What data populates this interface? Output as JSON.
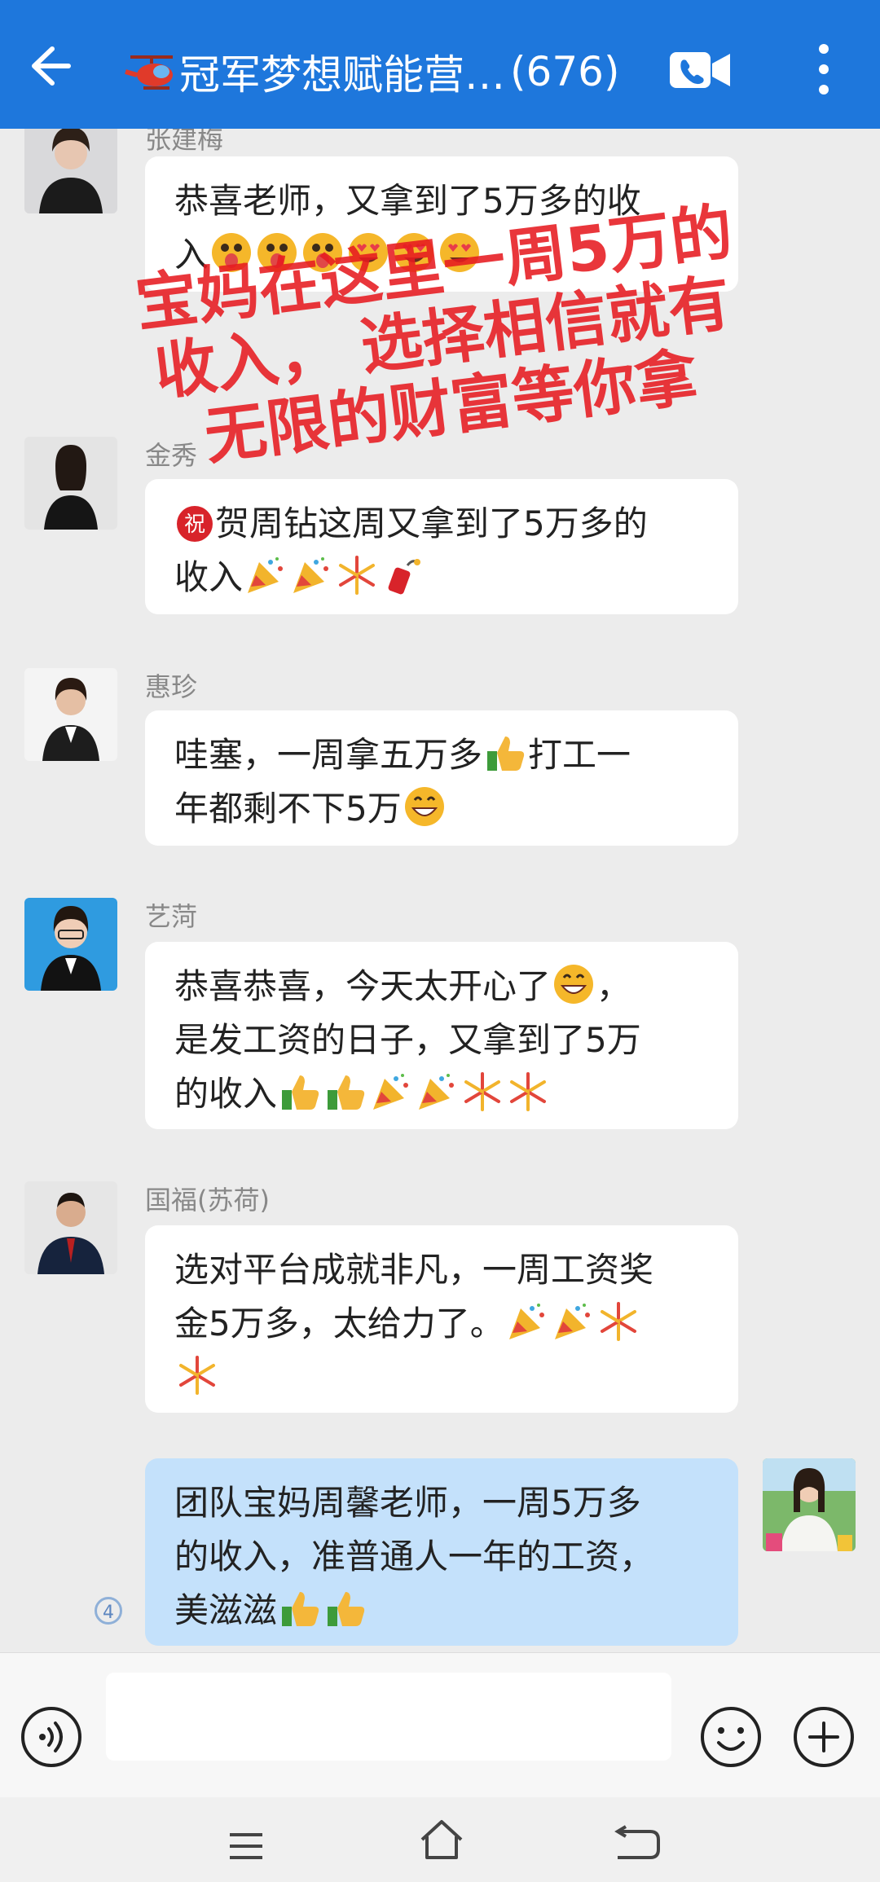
{
  "header": {
    "title": "冠军梦想赋能营…",
    "member_count": "(676)",
    "back_icon": "back-arrow-icon",
    "video_icon": "video-call-icon",
    "more_icon": "more-vertical-icon",
    "color": "#1e77dc"
  },
  "watermark": {
    "line1": "宝妈在这里一周5万的",
    "line2": "收入， 选择相信就有",
    "line3": "无限的财富等你拿",
    "color": "#e61a20"
  },
  "messages": [
    {
      "sender": "张建梅",
      "text_a": "恭喜老师，又拿到了5万多的收",
      "text_b": "入"
    },
    {
      "sender": "金秀",
      "text_a": "贺周钻这周又拿到了5万多的",
      "text_b": "收入"
    },
    {
      "sender": "惠珍",
      "text_a": "哇塞，一周拿五万多",
      "text_a2": "打工一",
      "text_b": "年都剩不下5万"
    },
    {
      "sender": "艺菏",
      "text_a": "恭喜恭喜，今天太开心了",
      "text_a2": "，",
      "text_b": "是发工资的日子，又拿到了5万",
      "text_c": "的收入"
    },
    {
      "sender": "国福(苏荷)",
      "text_a": "选对平台成就非凡，一周工资奖",
      "text_b": "金5万多，太给力了。"
    },
    {
      "sender": "",
      "text_a": "团队宝妈周馨老师，一周5万多",
      "text_b": "的收入，准普通人一年的工资，",
      "text_c": "美滋滋",
      "read_count": "4"
    }
  ],
  "input": {
    "voice_icon": "voice-icon",
    "emoji_icon": "emoji-icon",
    "plus_icon": "plus-icon",
    "value": ""
  },
  "nav": {
    "menu_icon": "menu-icon",
    "home_icon": "home-icon",
    "back_icon": "back-icon"
  }
}
